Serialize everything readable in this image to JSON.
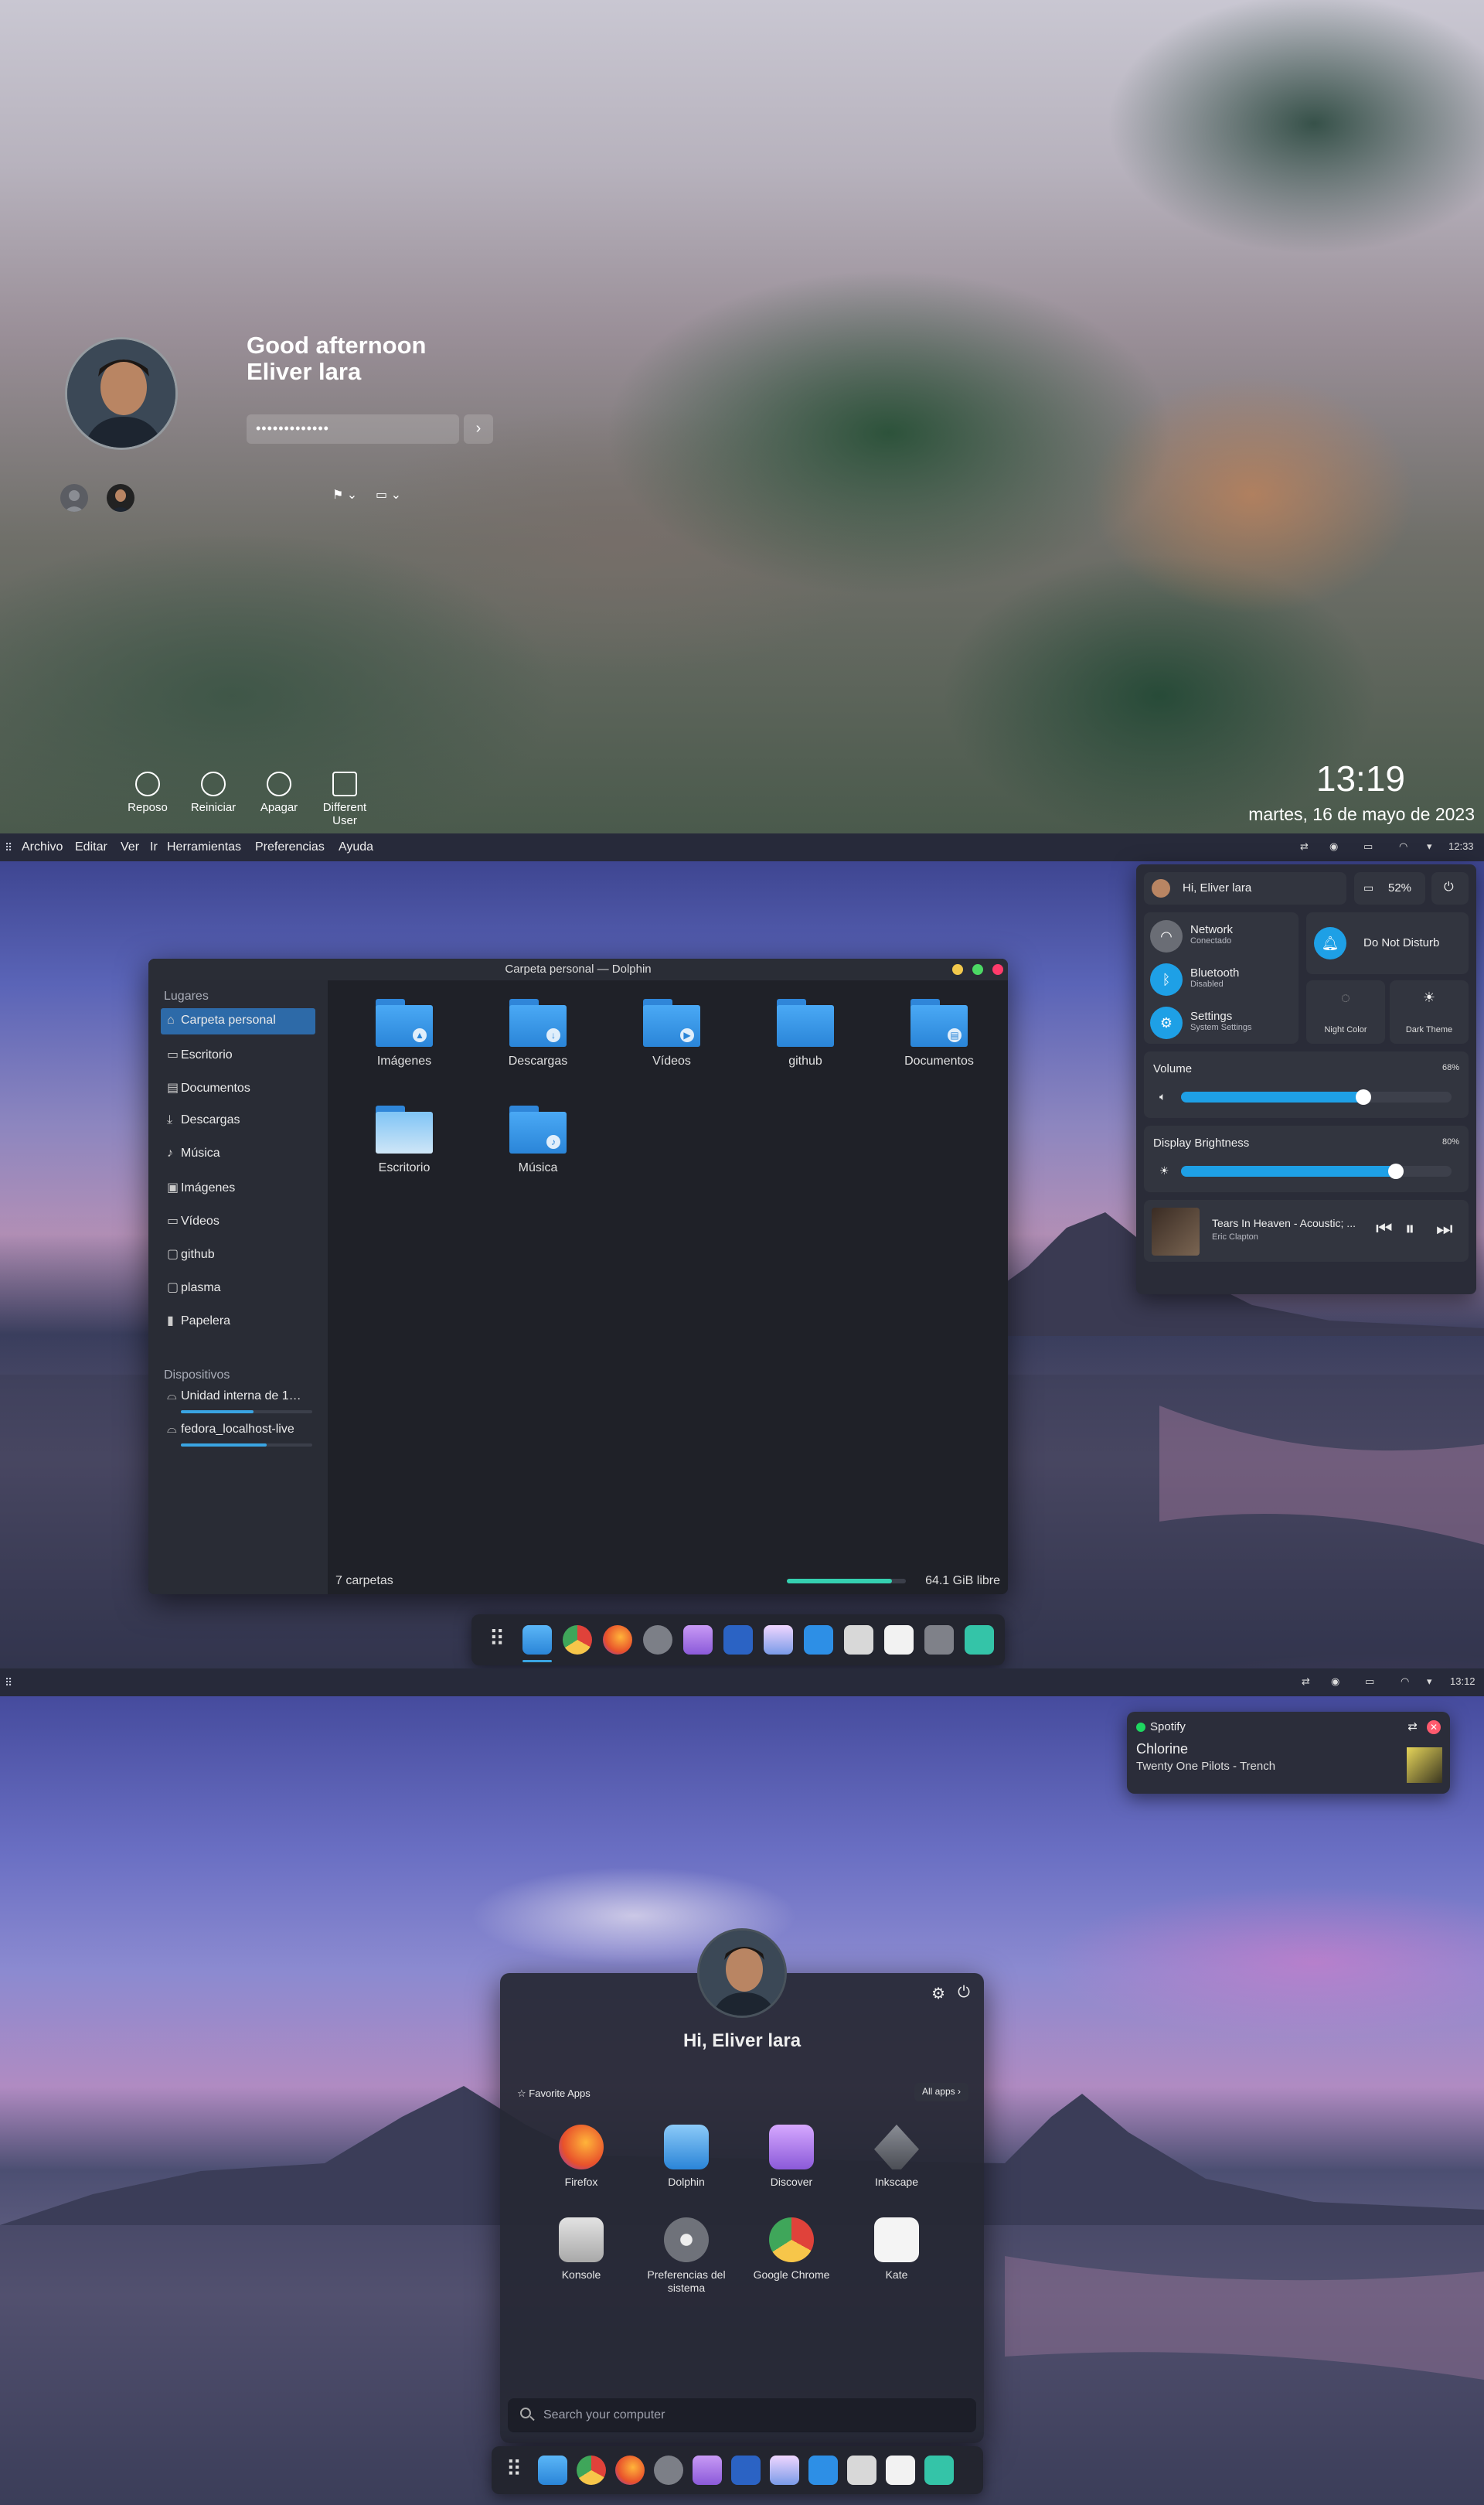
{
  "lock": {
    "greeting_line1": "Good afternoon",
    "greeting_line2": "Eliver lara",
    "password_mask": "•••••••••••••",
    "go_glyph": "›",
    "actions": [
      {
        "label": "Reposo",
        "icon": "sleep-icon"
      },
      {
        "label": "Reiniciar",
        "icon": "restart-icon"
      },
      {
        "label": "Apagar",
        "icon": "power-icon"
      },
      {
        "label": "Different User",
        "icon": "switch-user-icon"
      }
    ],
    "time": "13:19",
    "date": "martes, 16 de mayo de 2023"
  },
  "desktop1": {
    "menu": [
      "Archivo",
      "Editar",
      "Ver",
      "Ir",
      "Herramientas",
      "Preferencias",
      "Ayuda"
    ],
    "tray_time": "12:33",
    "dolphin": {
      "title": "Carpeta personal — Dolphin",
      "places_header": "Lugares",
      "places": [
        {
          "label": "Carpeta personal",
          "icon": "⌂",
          "active": true
        },
        {
          "label": "Escritorio",
          "icon": "▭"
        },
        {
          "label": "Documentos",
          "icon": "▤"
        },
        {
          "label": "Descargas",
          "icon": "⤓"
        },
        {
          "label": "Música",
          "icon": "♪"
        },
        {
          "label": "Imágenes",
          "icon": "▣"
        },
        {
          "label": "Vídeos",
          "icon": "▭"
        },
        {
          "label": "github",
          "icon": "▢"
        },
        {
          "label": "plasma",
          "icon": "▢"
        },
        {
          "label": "Papelera",
          "icon": "▮"
        }
      ],
      "devices_header": "Dispositivos",
      "devices": [
        {
          "label": "Unidad interna de 1…",
          "usage": 0.55
        },
        {
          "label": "fedora_localhost-live",
          "usage": 0.65
        }
      ],
      "folders": [
        {
          "label": "Imágenes",
          "mark": "▲"
        },
        {
          "label": "Descargas",
          "mark": "↓"
        },
        {
          "label": "Vídeos",
          "mark": "▶"
        },
        {
          "label": "github",
          "mark": ""
        },
        {
          "label": "Documentos",
          "mark": "▤"
        },
        {
          "label": "Escritorio",
          "mark": ""
        },
        {
          "label": "Música",
          "mark": "♪"
        }
      ],
      "status_count": "7 carpetas",
      "status_free": "64.1 GiB libre",
      "free_space_fill": 0.88
    },
    "quick": {
      "user": "Hi, Eliver lara",
      "battery": "52%",
      "network_title": "Network",
      "network_sub": "Conectado",
      "bluetooth_title": "Bluetooth",
      "bluetooth_sub": "Disabled",
      "settings_title": "Settings",
      "settings_sub": "System Settings",
      "dnd": "Do Not Disturb",
      "night": "Night Color",
      "dark": "Dark Theme",
      "volume_label": "Volume",
      "volume_value": "68%",
      "volume": 0.68,
      "brightness_label": "Display Brightness",
      "brightness_value": "80%",
      "brightness": 0.8,
      "track": "Tears In Heaven - Acoustic; ...",
      "artist": "Eric Clapton"
    }
  },
  "desktop2": {
    "tray_time": "13:12",
    "notification": {
      "app": "Spotify",
      "song": "Chlorine",
      "artist_album": "Twenty One Pilots - Trench"
    },
    "launcher": {
      "greeting": "Hi, Eliver lara",
      "favorites_label": "Favorite Apps",
      "all_apps": "All apps",
      "apps": [
        {
          "label": "Firefox",
          "color": "#f2692a"
        },
        {
          "label": "Dolphin",
          "color": "#4aa9f5"
        },
        {
          "label": "Discover",
          "color": "#b07ae6"
        },
        {
          "label": "Inkscape",
          "color": "#666a73"
        },
        {
          "label": "Konsole",
          "color": "#c8c8c8"
        },
        {
          "label": "Preferencias del sistema",
          "color": "#9ea0a8"
        },
        {
          "label": "Google Chrome",
          "color": "#e0423a"
        },
        {
          "label": "Kate",
          "color": "#f4f4f4"
        }
      ],
      "search_placeholder": "Search your computer"
    }
  }
}
